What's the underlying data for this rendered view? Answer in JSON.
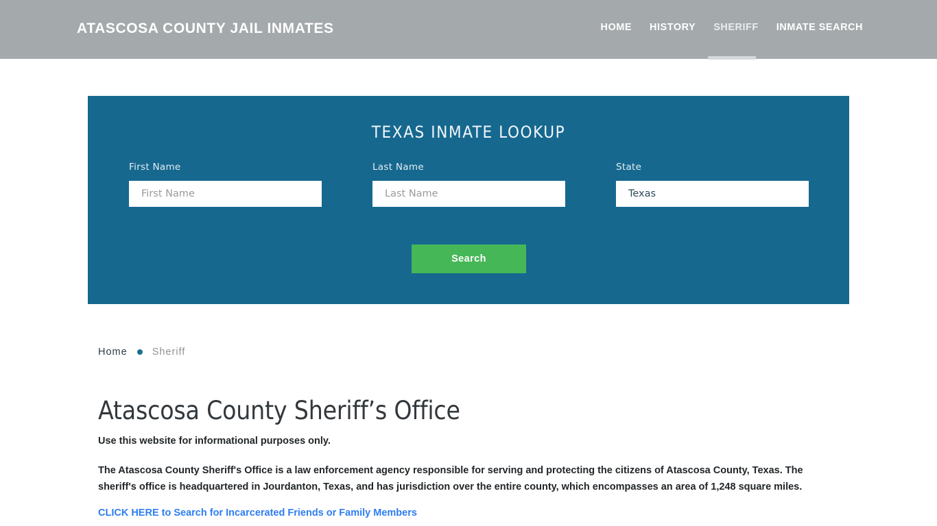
{
  "header": {
    "site_title": "ATASCOSA COUNTY JAIL INMATES",
    "nav": [
      {
        "label": "HOME",
        "active": false
      },
      {
        "label": "HISTORY",
        "active": false
      },
      {
        "label": "SHERIFF",
        "active": true
      },
      {
        "label": "INMATE SEARCH",
        "active": false
      }
    ],
    "bar_color": "#a4a9ac",
    "active_underline_color": "#d6d9db"
  },
  "lookup": {
    "title": "TEXAS INMATE LOOKUP",
    "panel_color": "#16688f",
    "fields": {
      "first_name": {
        "label": "First Name",
        "placeholder": "First Name",
        "value": ""
      },
      "last_name": {
        "label": "Last Name",
        "placeholder": "Last Name",
        "value": ""
      },
      "state": {
        "label": "State",
        "placeholder": "State",
        "value": "Texas"
      }
    },
    "search_label": "Search",
    "search_color": "#46b757"
  },
  "breadcrumb": {
    "home": "Home",
    "current": "Sheriff",
    "dot_color": "#1b6f8f"
  },
  "content": {
    "title": "Atascosa County Sheriff’s Office",
    "lede": "Use this website for informational purposes only.",
    "paragraph": "The Atascosa County Sheriff's Office is a law enforcement agency responsible for serving and protecting the citizens of Atascosa County, Texas. The sheriff's office is headquartered in Jourdanton, Texas, and has jurisdiction over the entire county, which encompasses an area of 1,248 square miles.",
    "cta_link": "CLICK HERE to Search for Incarcerated Friends or Family Members",
    "cta_color": "#2e7df0"
  }
}
